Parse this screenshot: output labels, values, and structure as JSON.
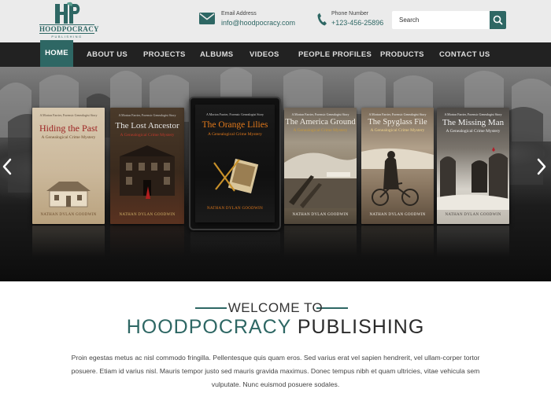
{
  "brand": {
    "logo_monogram": "HP",
    "logo_name": "HOODPOCRACY",
    "logo_tagline": "PUBLISHING"
  },
  "contact": {
    "email_label": "Email Address",
    "email_value": "info@hoodpocracy.com",
    "phone_label": "Phone Number",
    "phone_value": "+123-456-25896"
  },
  "search": {
    "placeholder": "Search"
  },
  "nav": {
    "items": [
      {
        "label": "HOME",
        "active": true
      },
      {
        "label": "ABOUT US"
      },
      {
        "label": "PROJECTS"
      },
      {
        "label": "ALBUMS"
      },
      {
        "label": "VIDEOS"
      },
      {
        "label": "PEOPLE PROFILES"
      },
      {
        "label": "PRODUCTS"
      },
      {
        "label": "CONTACT US"
      }
    ]
  },
  "hero": {
    "books": [
      {
        "blurb": "A Morton Farrier, Forensic Genealogist Story",
        "title": "Hiding the Past",
        "subtitle": "A Genealogical Crime Mystery",
        "author": "NATHAN DYLAN GOODWIN"
      },
      {
        "blurb": "A Morton Farrier, Forensic Genealogist Story",
        "title": "The Lost Ancestor",
        "subtitle": "A Genealogical Crime Mystery",
        "author": "NATHAN DYLAN GOODWIN"
      },
      {
        "blurb": "A Morton Farrier, Forensic Genealogist Story",
        "title": "The Orange Lilies",
        "subtitle": "A Genealogical Crime Mystery",
        "author": "NATHAN DYLAN GOODWIN"
      },
      {
        "blurb": "A Morton Farrier, Forensic Genealogist Story",
        "title": "The America Ground",
        "subtitle": "A Genealogical Crime Mystery",
        "author": "NATHAN DYLAN GOODWIN"
      },
      {
        "blurb": "A Morton Farrier, Forensic Genealogist Story",
        "title": "The Spyglass File",
        "subtitle": "A Genealogical Crime Mystery",
        "author": "NATHAN DYLAN GOODWIN"
      },
      {
        "blurb": "A Morton Farrier, Forensic Genealogist Story",
        "title": "The Missing Man",
        "subtitle": "A Genealogical Crime Mystery",
        "author": "NATHAN DYLAN GOODWIN"
      }
    ]
  },
  "welcome": {
    "heading": "WELCOME TO",
    "brand_part1": "HOODPOCRACY",
    "brand_part2": "PUBLISHING",
    "body": "Proin egestas metus ac nisl commodo fringilla. Pellentesque quis quam eros. Sed varius erat vel sapien hendrerit, vel ullam-corper tortor posuere. Etiam id varius nisl. Mauris tempor justo sed mauris gravida maximus. Donec tempus nibh et quam ultricies, vitae vehicula sem vulputate. Nunc euismod posuere sodales."
  },
  "colors": {
    "accent": "#2e6764",
    "nav_bg": "#222222",
    "header_bg": "#ebebeb"
  },
  "icons": {
    "email": "envelope-icon",
    "phone": "phone-icon",
    "search": "search-icon",
    "prev": "chevron-left-icon",
    "next": "chevron-right-icon"
  }
}
